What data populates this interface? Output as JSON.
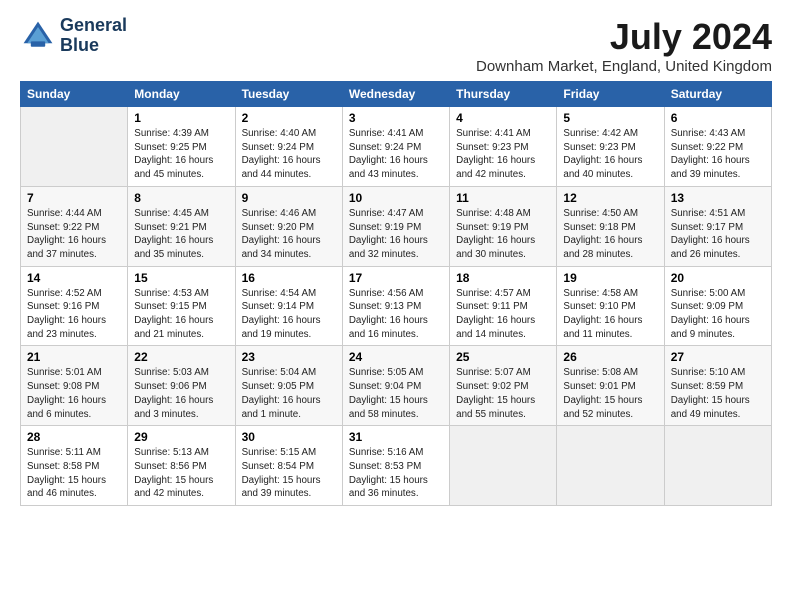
{
  "header": {
    "logo_line1": "General",
    "logo_line2": "Blue",
    "month_year": "July 2024",
    "location": "Downham Market, England, United Kingdom"
  },
  "weekdays": [
    "Sunday",
    "Monday",
    "Tuesday",
    "Wednesday",
    "Thursday",
    "Friday",
    "Saturday"
  ],
  "weeks": [
    [
      {
        "day": "",
        "info": ""
      },
      {
        "day": "1",
        "info": "Sunrise: 4:39 AM\nSunset: 9:25 PM\nDaylight: 16 hours\nand 45 minutes."
      },
      {
        "day": "2",
        "info": "Sunrise: 4:40 AM\nSunset: 9:24 PM\nDaylight: 16 hours\nand 44 minutes."
      },
      {
        "day": "3",
        "info": "Sunrise: 4:41 AM\nSunset: 9:24 PM\nDaylight: 16 hours\nand 43 minutes."
      },
      {
        "day": "4",
        "info": "Sunrise: 4:41 AM\nSunset: 9:23 PM\nDaylight: 16 hours\nand 42 minutes."
      },
      {
        "day": "5",
        "info": "Sunrise: 4:42 AM\nSunset: 9:23 PM\nDaylight: 16 hours\nand 40 minutes."
      },
      {
        "day": "6",
        "info": "Sunrise: 4:43 AM\nSunset: 9:22 PM\nDaylight: 16 hours\nand 39 minutes."
      }
    ],
    [
      {
        "day": "7",
        "info": "Sunrise: 4:44 AM\nSunset: 9:22 PM\nDaylight: 16 hours\nand 37 minutes."
      },
      {
        "day": "8",
        "info": "Sunrise: 4:45 AM\nSunset: 9:21 PM\nDaylight: 16 hours\nand 35 minutes."
      },
      {
        "day": "9",
        "info": "Sunrise: 4:46 AM\nSunset: 9:20 PM\nDaylight: 16 hours\nand 34 minutes."
      },
      {
        "day": "10",
        "info": "Sunrise: 4:47 AM\nSunset: 9:19 PM\nDaylight: 16 hours\nand 32 minutes."
      },
      {
        "day": "11",
        "info": "Sunrise: 4:48 AM\nSunset: 9:19 PM\nDaylight: 16 hours\nand 30 minutes."
      },
      {
        "day": "12",
        "info": "Sunrise: 4:50 AM\nSunset: 9:18 PM\nDaylight: 16 hours\nand 28 minutes."
      },
      {
        "day": "13",
        "info": "Sunrise: 4:51 AM\nSunset: 9:17 PM\nDaylight: 16 hours\nand 26 minutes."
      }
    ],
    [
      {
        "day": "14",
        "info": "Sunrise: 4:52 AM\nSunset: 9:16 PM\nDaylight: 16 hours\nand 23 minutes."
      },
      {
        "day": "15",
        "info": "Sunrise: 4:53 AM\nSunset: 9:15 PM\nDaylight: 16 hours\nand 21 minutes."
      },
      {
        "day": "16",
        "info": "Sunrise: 4:54 AM\nSunset: 9:14 PM\nDaylight: 16 hours\nand 19 minutes."
      },
      {
        "day": "17",
        "info": "Sunrise: 4:56 AM\nSunset: 9:13 PM\nDaylight: 16 hours\nand 16 minutes."
      },
      {
        "day": "18",
        "info": "Sunrise: 4:57 AM\nSunset: 9:11 PM\nDaylight: 16 hours\nand 14 minutes."
      },
      {
        "day": "19",
        "info": "Sunrise: 4:58 AM\nSunset: 9:10 PM\nDaylight: 16 hours\nand 11 minutes."
      },
      {
        "day": "20",
        "info": "Sunrise: 5:00 AM\nSunset: 9:09 PM\nDaylight: 16 hours\nand 9 minutes."
      }
    ],
    [
      {
        "day": "21",
        "info": "Sunrise: 5:01 AM\nSunset: 9:08 PM\nDaylight: 16 hours\nand 6 minutes."
      },
      {
        "day": "22",
        "info": "Sunrise: 5:03 AM\nSunset: 9:06 PM\nDaylight: 16 hours\nand 3 minutes."
      },
      {
        "day": "23",
        "info": "Sunrise: 5:04 AM\nSunset: 9:05 PM\nDaylight: 16 hours\nand 1 minute."
      },
      {
        "day": "24",
        "info": "Sunrise: 5:05 AM\nSunset: 9:04 PM\nDaylight: 15 hours\nand 58 minutes."
      },
      {
        "day": "25",
        "info": "Sunrise: 5:07 AM\nSunset: 9:02 PM\nDaylight: 15 hours\nand 55 minutes."
      },
      {
        "day": "26",
        "info": "Sunrise: 5:08 AM\nSunset: 9:01 PM\nDaylight: 15 hours\nand 52 minutes."
      },
      {
        "day": "27",
        "info": "Sunrise: 5:10 AM\nSunset: 8:59 PM\nDaylight: 15 hours\nand 49 minutes."
      }
    ],
    [
      {
        "day": "28",
        "info": "Sunrise: 5:11 AM\nSunset: 8:58 PM\nDaylight: 15 hours\nand 46 minutes."
      },
      {
        "day": "29",
        "info": "Sunrise: 5:13 AM\nSunset: 8:56 PM\nDaylight: 15 hours\nand 42 minutes."
      },
      {
        "day": "30",
        "info": "Sunrise: 5:15 AM\nSunset: 8:54 PM\nDaylight: 15 hours\nand 39 minutes."
      },
      {
        "day": "31",
        "info": "Sunrise: 5:16 AM\nSunset: 8:53 PM\nDaylight: 15 hours\nand 36 minutes."
      },
      {
        "day": "",
        "info": ""
      },
      {
        "day": "",
        "info": ""
      },
      {
        "day": "",
        "info": ""
      }
    ]
  ]
}
